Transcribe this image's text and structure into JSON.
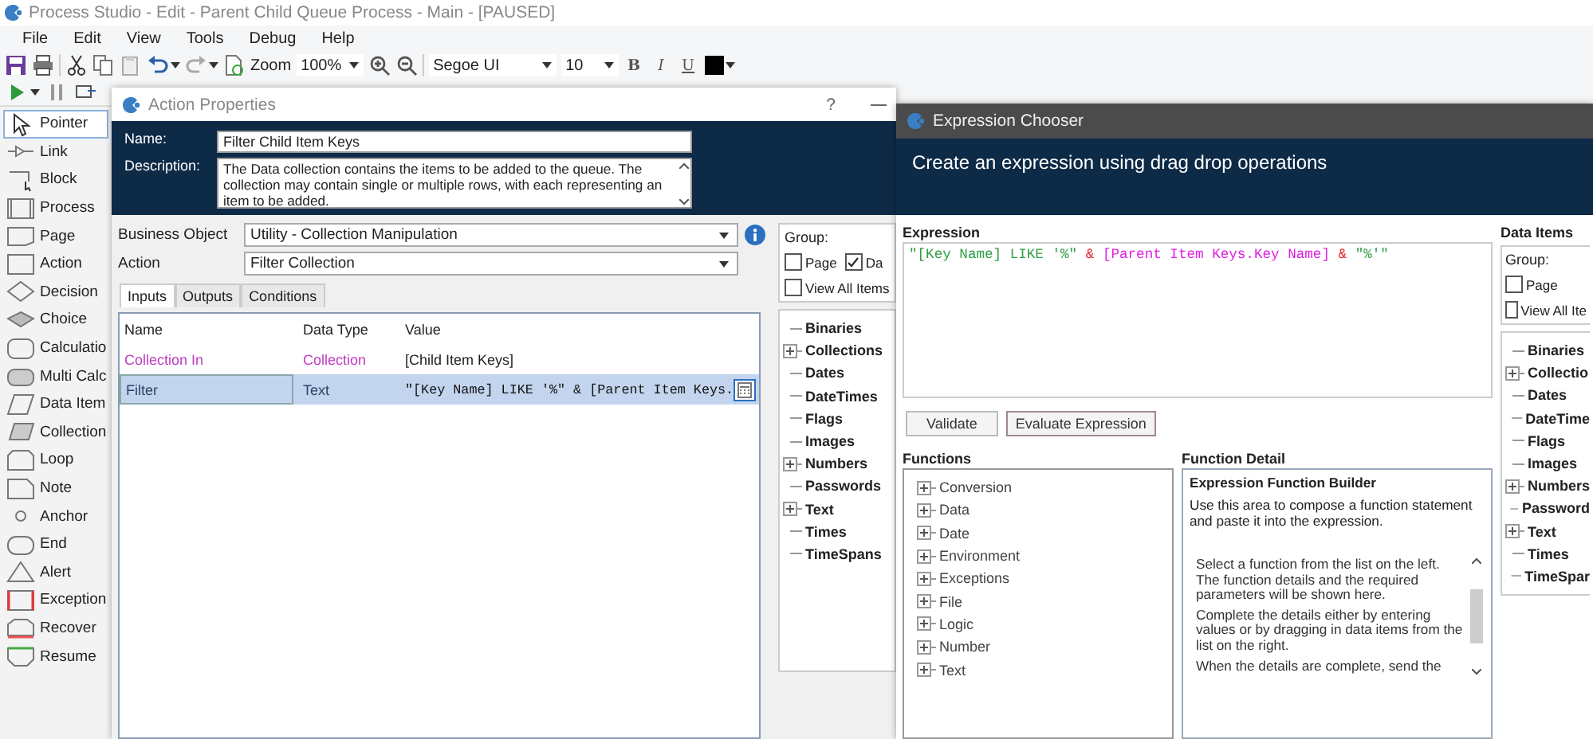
{
  "window": {
    "title": "Process Studio  - Edit - Parent Child Queue Process - Main - [PAUSED]"
  },
  "menu": [
    "File",
    "Edit",
    "View",
    "Tools",
    "Debug",
    "Help"
  ],
  "toolbar": {
    "zoom_label": "Zoom",
    "zoom": "100%",
    "font": "Segoe UI",
    "size": "10",
    "bold": "B",
    "italic": "I",
    "underline": "U"
  },
  "palette": [
    {
      "label": "Pointer",
      "kind": "pointer",
      "selected": true
    },
    {
      "label": "Link",
      "kind": "link",
      "selected": false
    },
    {
      "label": "Block",
      "kind": "block",
      "selected": false
    },
    {
      "label": "Process",
      "kind": "process",
      "selected": false
    },
    {
      "label": "Page",
      "kind": "page",
      "selected": false
    },
    {
      "label": "Action",
      "kind": "action",
      "selected": false
    },
    {
      "label": "Decision",
      "kind": "decision",
      "selected": false
    },
    {
      "label": "Choice",
      "kind": "choice",
      "selected": false
    },
    {
      "label": "Calculatio",
      "kind": "calculation",
      "selected": false
    },
    {
      "label": "Multi Calc",
      "kind": "multicalc",
      "selected": false
    },
    {
      "label": "Data Item",
      "kind": "dataitem",
      "selected": false
    },
    {
      "label": "Collection",
      "kind": "collection",
      "selected": false
    },
    {
      "label": "Loop",
      "kind": "loop",
      "selected": false
    },
    {
      "label": "Note",
      "kind": "note",
      "selected": false
    },
    {
      "label": "Anchor",
      "kind": "anchor",
      "selected": false
    },
    {
      "label": "End",
      "kind": "end",
      "selected": false
    },
    {
      "label": "Alert",
      "kind": "alert",
      "selected": false
    },
    {
      "label": "Exception",
      "kind": "exception",
      "selected": false
    },
    {
      "label": "Recover",
      "kind": "recover",
      "selected": false
    },
    {
      "label": "Resume",
      "kind": "resume",
      "selected": false
    }
  ],
  "action_properties": {
    "title": "Action Properties",
    "help": "?",
    "name_label": "Name:",
    "name": "Filter Child Item Keys",
    "description_label": "Description:",
    "description": "The Data collection contains the items to be added to the queue. The collection may contain single or multiple rows, with each representing an item to be added.",
    "business_object_label": "Business Object",
    "business_object": "Utility - Collection Manipulation",
    "action_label": "Action",
    "action": "Filter Collection",
    "tabs": [
      {
        "label": "Inputs",
        "selected": true
      },
      {
        "label": "Outputs",
        "selected": false
      },
      {
        "label": "Conditions",
        "selected": false
      }
    ],
    "columns": [
      "Name",
      "Data Type",
      "Value"
    ],
    "rows": [
      {
        "name": "Collection In",
        "data_type": "Collection",
        "value": "[Child Item Keys]",
        "selected": false
      },
      {
        "name": "Filter",
        "data_type": "Text",
        "value": "\"[Key Name] LIKE '%\" & [Parent Item Keys.",
        "selected": true
      }
    ],
    "group_label": "Group:",
    "group_options": [
      {
        "label": "Page",
        "checked": false
      },
      {
        "label": "Da",
        "checked": true
      },
      {
        "label": "View All Items",
        "checked": false
      }
    ],
    "data_items": [
      {
        "label": "Binaries",
        "expandable": false
      },
      {
        "label": "Collections",
        "expandable": true
      },
      {
        "label": "Dates",
        "expandable": false
      },
      {
        "label": "DateTimes",
        "expandable": false
      },
      {
        "label": "Flags",
        "expandable": false
      },
      {
        "label": "Images",
        "expandable": false
      },
      {
        "label": "Numbers",
        "expandable": true
      },
      {
        "label": "Passwords",
        "expandable": false
      },
      {
        "label": "Text",
        "expandable": true
      },
      {
        "label": "Times",
        "expandable": false
      },
      {
        "label": "TimeSpans",
        "expandable": false
      }
    ]
  },
  "expression_chooser": {
    "title": "Expression Chooser",
    "heading": "Create an expression using drag drop operations",
    "expression_label": "Expression",
    "expression": [
      {
        "text": "\"[Key Name] LIKE '%\"",
        "kind": "string"
      },
      {
        "text": "&",
        "kind": "operator"
      },
      {
        "text": "[Parent Item Keys.Key Name]",
        "kind": "item"
      },
      {
        "text": "&",
        "kind": "operator"
      },
      {
        "text": "\"%'\"",
        "kind": "string"
      }
    ],
    "buttons": [
      "Validate",
      "Evaluate Expression"
    ],
    "functions_label": "Functions",
    "functions": [
      "Conversion",
      "Data",
      "Date",
      "Environment",
      "Exceptions",
      "File",
      "Logic",
      "Number",
      "Text"
    ],
    "detail_label": "Function Detail",
    "detail_title": "Expression Function Builder",
    "detail_intro": "Use this area to compose a function statement and paste it into the expression.",
    "detail_help": [
      "Select a function from the list on the left. The function details and the required parameters will be shown here.",
      "Complete the details either by entering values or by dragging in data items from the list on the right.",
      "When the details are complete, send the"
    ],
    "data_items_label": "Data Items",
    "group_label": "Group:",
    "group_options": [
      {
        "label": "Page",
        "checked": false
      },
      {
        "label": "View All Ite",
        "checked": false
      }
    ],
    "data_items": [
      {
        "label": "Binaries",
        "expandable": false
      },
      {
        "label": "Collectio",
        "expandable": true
      },
      {
        "label": "Dates",
        "expandable": false
      },
      {
        "label": "DateTime",
        "expandable": false
      },
      {
        "label": "Flags",
        "expandable": false
      },
      {
        "label": "Images",
        "expandable": false
      },
      {
        "label": "Numbers",
        "expandable": true
      },
      {
        "label": "Password",
        "expandable": false
      },
      {
        "label": "Text",
        "expandable": true
      },
      {
        "label": "Times",
        "expandable": false
      },
      {
        "label": "TimeSpar",
        "expandable": false
      }
    ]
  }
}
